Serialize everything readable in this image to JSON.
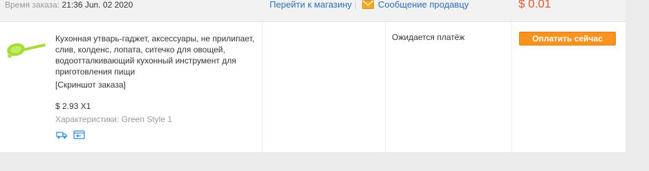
{
  "header": {
    "order_time_label": "Время заказа:",
    "order_time_value": "21:36 Jun. 02 2020",
    "store_link": "Перейти к магазину",
    "separator": "|",
    "message_seller": "Сообщение продавцу",
    "total": "$ 0.01"
  },
  "item": {
    "title": "Кухонная утварь-гаджет, аксессуары, не прилипает, слив, колденс, лопата, ситечко для овощей, водоотталкивающий кухонный инструмент для приготовления пищи",
    "screenshot_link": "[Скриншот заказа]",
    "price": "$ 2.93 X1",
    "properties": "Характеристики: Green Style 1",
    "icons": [
      "delivery-truck-icon",
      "return-card-icon"
    ]
  },
  "status": "Ожидается платёж",
  "pay_button": "Оплатить сейчас",
  "colors": {
    "link": "#2a6fb7",
    "total": "#e4572e",
    "button": "#f7931e",
    "thumbnail": "#a6dc3a",
    "icon": "#2a86d6"
  }
}
